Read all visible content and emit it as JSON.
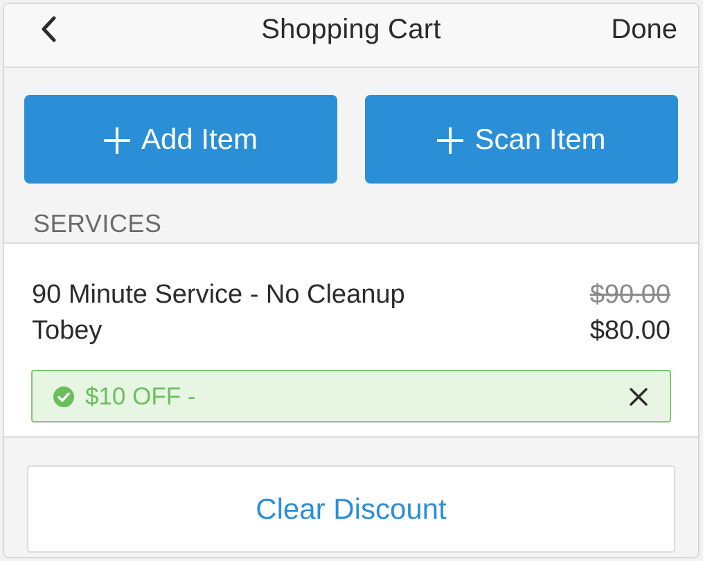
{
  "header": {
    "title": "Shopping Cart",
    "done_label": "Done"
  },
  "actions": {
    "add_label": "Add Item",
    "scan_label": "Scan Item"
  },
  "services": {
    "section_label": "SERVICES",
    "item": {
      "name": "90 Minute Service - No Cleanup",
      "staff": "Tobey",
      "original_price": "$90.00",
      "final_price": "$80.00"
    },
    "discount": {
      "label": "$10 OFF - ",
      "status_icon": "check-circle-icon",
      "remove_icon": "close-icon"
    }
  },
  "footer": {
    "clear_label": "Clear Discount"
  },
  "colors": {
    "accent": "#2b8fd8",
    "success": "#6bbf5b",
    "success_bg": "#e7f5e3"
  }
}
